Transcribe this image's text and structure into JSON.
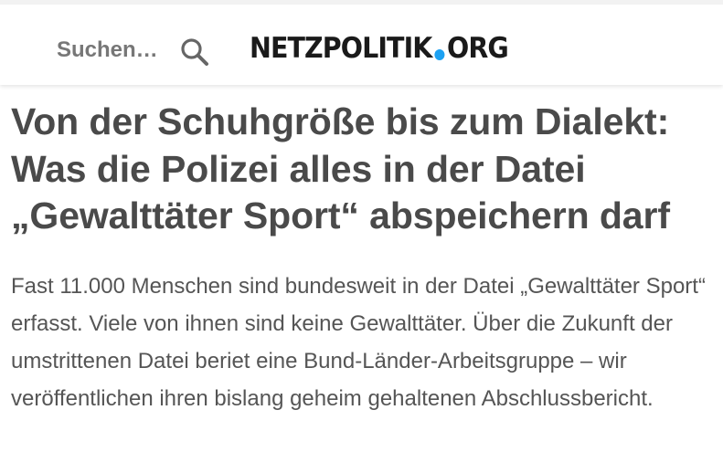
{
  "header": {
    "search": {
      "placeholder": "Suchen…",
      "icon": "search-icon"
    },
    "logo": {
      "left_text": "NETZPOLITIK",
      "right_text": "ORG",
      "dot_color": "#1da1f2"
    }
  },
  "article": {
    "headline_lines": [
      "Von der Schuhgröße bis zum Dialekt:",
      "Was die Polizei alles in der Datei",
      "„Gewalttäter Sport“ abspeichern darf"
    ],
    "lead": "Fast 11.000 Menschen sind bundesweit in der Datei „Gewalttäter Sport“ erfasst. Viele von ihnen sind keine Gewalttäter. Über die Zukunft der umstrittenen Datei beriet eine Bund-Länder-Arbeitsgruppe – wir veröffentlichen ihren bislang geheim gehaltenen Abschlussbericht."
  },
  "colors": {
    "text": "#4a4a4a",
    "placeholder": "#777777",
    "logo_text": "#1a1a1a",
    "accent": "#1da1f2"
  }
}
